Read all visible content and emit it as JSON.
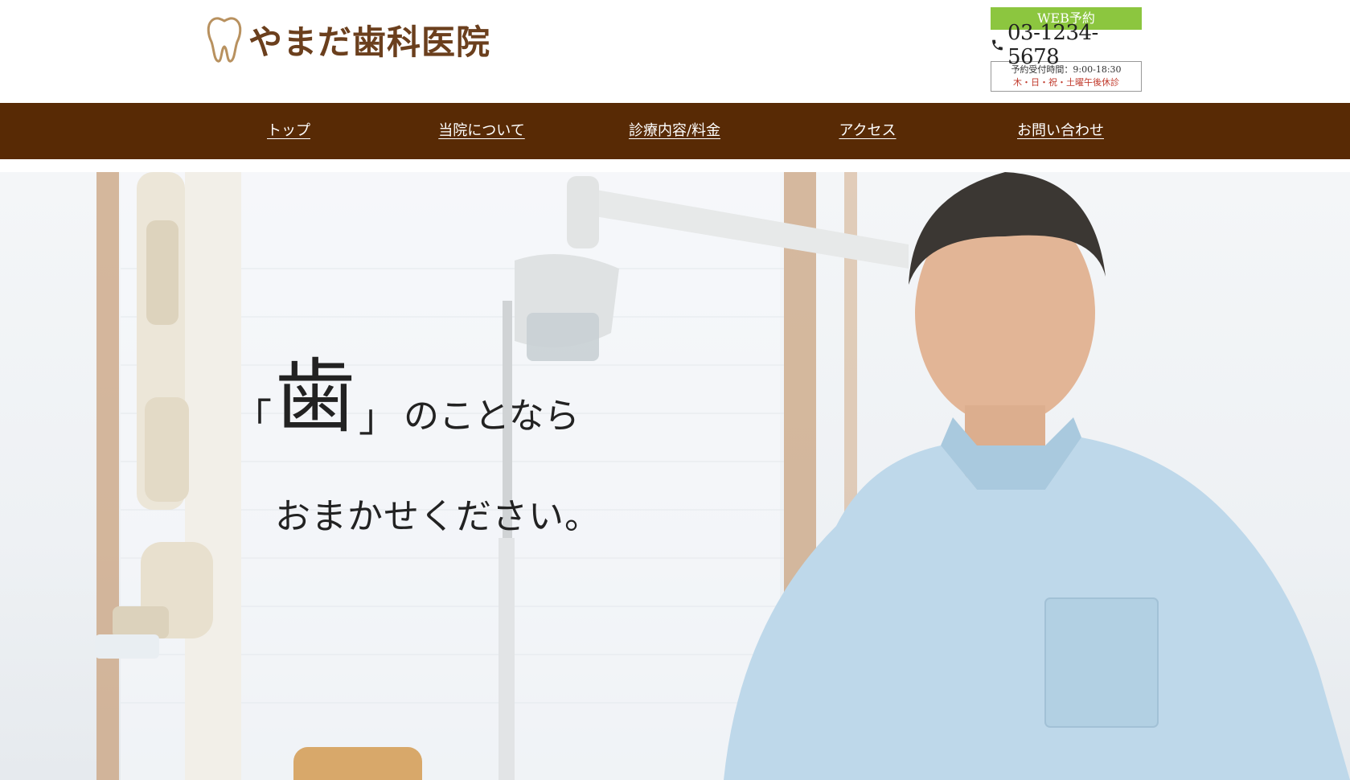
{
  "header": {
    "logo_text": "やまだ歯科医院",
    "web_reserve_label": "WEB予約",
    "tel": "03-1234-5678",
    "hours_line1": "予約受付時間：9:00-18:30",
    "hours_line2": "木・日・祝・土曜午後休診"
  },
  "nav": {
    "items": [
      {
        "label": "トップ"
      },
      {
        "label": "当院について"
      },
      {
        "label": "診療内容/料金"
      },
      {
        "label": "アクセス"
      },
      {
        "label": "お問い合わせ"
      }
    ]
  },
  "hero": {
    "bracket_open": "「",
    "big_char": "歯",
    "bracket_close": "」",
    "catch_line1_rest": "のことなら",
    "catch_line2": "おまかせください。"
  },
  "colors": {
    "nav_bg": "#582a05",
    "logo_brown": "#6b3f1d",
    "web_button_green": "#8cc63f",
    "closed_days_red": "#c0392b"
  },
  "icons": [
    "tooth-logo-icon",
    "phone-icon"
  ]
}
